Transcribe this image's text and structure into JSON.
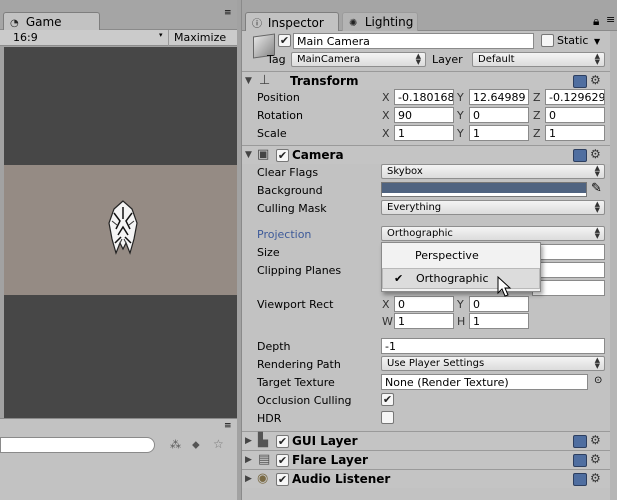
{
  "game": {
    "tab_label": "Game",
    "aspect": "16:9",
    "maximize": "Maximize on"
  },
  "inspector": {
    "tab_label": "Inspector",
    "lighting_tab_label": "Lighting",
    "object_name": "Main Camera",
    "static_label": "Static",
    "tag_label": "Tag",
    "tag_value": "MainCamera",
    "layer_label": "Layer",
    "layer_value": "Default"
  },
  "transform": {
    "title": "Transform",
    "position_label": "Position",
    "position": {
      "x": "-0.180168",
      "y": "12.64989",
      "z": "-0.129629"
    },
    "rotation_label": "Rotation",
    "rotation": {
      "x": "90",
      "y": "0",
      "z": "0"
    },
    "scale_label": "Scale",
    "scale": {
      "x": "1",
      "y": "1",
      "z": "1"
    }
  },
  "camera": {
    "title": "Camera",
    "clear_flags_label": "Clear Flags",
    "clear_flags": "Skybox",
    "background_label": "Background",
    "background_color": "#4f6380",
    "culling_mask_label": "Culling Mask",
    "culling_mask": "Everything",
    "projection_label": "Projection",
    "projection": "Orthographic",
    "size_label": "Size",
    "clipping_label": "Clipping Planes",
    "viewport_label": "Viewport Rect",
    "viewport": {
      "x": "0",
      "y": "0",
      "w": "1",
      "h": "1"
    },
    "depth_label": "Depth",
    "depth": "-1",
    "rendering_path_label": "Rendering Path",
    "rendering_path": "Use Player Settings",
    "target_texture_label": "Target Texture",
    "target_texture": "None (Render Texture)",
    "occlusion_label": "Occlusion Culling",
    "hdr_label": "HDR"
  },
  "popup": {
    "options": [
      "Perspective",
      "Orthographic"
    ],
    "checkmark": "✔"
  },
  "axes": {
    "x": "X",
    "y": "Y",
    "z": "Z",
    "w": "W",
    "h": "H"
  },
  "components": {
    "gui_layer": "GUI Layer",
    "flare_layer": "Flare Layer",
    "audio_listener": "Audio Listener"
  },
  "colors": {
    "panel": "#c2c2c2",
    "game_bg": "#474747",
    "ground": "#958b84",
    "projection_label": "#3d5a99"
  }
}
